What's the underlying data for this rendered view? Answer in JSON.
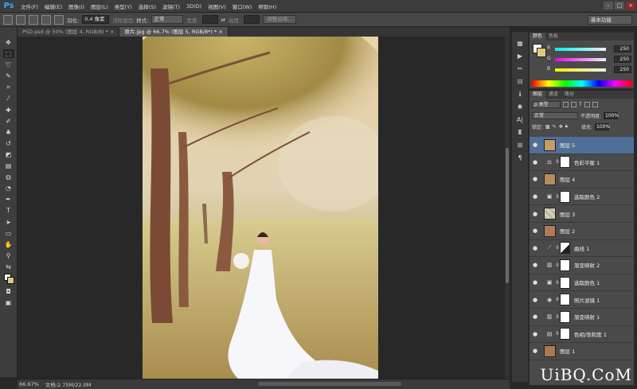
{
  "app": {
    "logo": "Ps"
  },
  "menu": [
    "文件(F)",
    "编辑(E)",
    "图像(I)",
    "图层(L)",
    "类型(Y)",
    "选择(S)",
    "滤镜(T)",
    "3D(D)",
    "视图(V)",
    "窗口(W)",
    "帮助(H)"
  ],
  "window_controls": {
    "minimize": "–",
    "maximize": "□",
    "close": "×"
  },
  "options": {
    "feather_label": "羽化:",
    "feather_value": "0.4 像素",
    "antialias_label": "消除锯齿",
    "style_label": "样式:",
    "style_value": "正常",
    "width_label": "宽度:",
    "height_label": "高度:",
    "refine_edge": "调整边缘...",
    "workspace": "基本功能"
  },
  "doc_tabs": [
    {
      "label": "PSD.psd @ 50% (图层 4, RGB/8) * ×",
      "active": false
    },
    {
      "label": "原片.jpg @ 66.7% (图层 5, RGB/8*) * ×",
      "active": true
    }
  ],
  "status": {
    "zoom": "66.67%",
    "doc_size": "文档:2.75M/22.0M"
  },
  "color_panel": {
    "tabs": [
      "颜色",
      "色板"
    ],
    "r_label": "R",
    "r_value": "250",
    "g_label": "G",
    "g_value": "250",
    "b_label": "B",
    "b_value": "250"
  },
  "layers_panel": {
    "tabs": [
      "图层",
      "通道",
      "路径"
    ],
    "filter_type": "ρ 类型",
    "blend_mode": "正常",
    "opacity_label": "不透明度:",
    "opacity_value": "100%",
    "lock_label": "锁定:",
    "fill_label": "填充:",
    "fill_value": "100%",
    "layers": [
      {
        "name": "图层 5",
        "kind": "photo",
        "selected": true
      },
      {
        "name": "色彩平衡 1",
        "kind": "adjustment",
        "icon": "balance-icon"
      },
      {
        "name": "图层 4",
        "kind": "photo"
      },
      {
        "name": "选取颜色 2",
        "kind": "adjustment",
        "icon": "selective-color-icon"
      },
      {
        "name": "图层 3",
        "kind": "texture"
      },
      {
        "name": "图层 2",
        "kind": "photo"
      },
      {
        "name": "曲线 1",
        "kind": "adjustment",
        "icon": "curves-icon"
      },
      {
        "name": "渐变映射 2",
        "kind": "adjustment",
        "icon": "gradient-map-icon"
      },
      {
        "name": "选取颜色 1",
        "kind": "adjustment",
        "icon": "selective-color-icon"
      },
      {
        "name": "照片滤镜 1",
        "kind": "adjustment",
        "icon": "photo-filter-icon"
      },
      {
        "name": "渐变映射 1",
        "kind": "adjustment",
        "icon": "gradient-map-icon"
      },
      {
        "name": "色相/饱和度 1",
        "kind": "adjustment",
        "icon": "hue-saturation-icon"
      },
      {
        "name": "图层 1",
        "kind": "photo"
      }
    ]
  },
  "watermark": {
    "text": "UiBQ.CoM"
  },
  "colors": {
    "selected_layer": "#4f6f96",
    "foreground": "#fafafa",
    "background": "#e2c780"
  }
}
